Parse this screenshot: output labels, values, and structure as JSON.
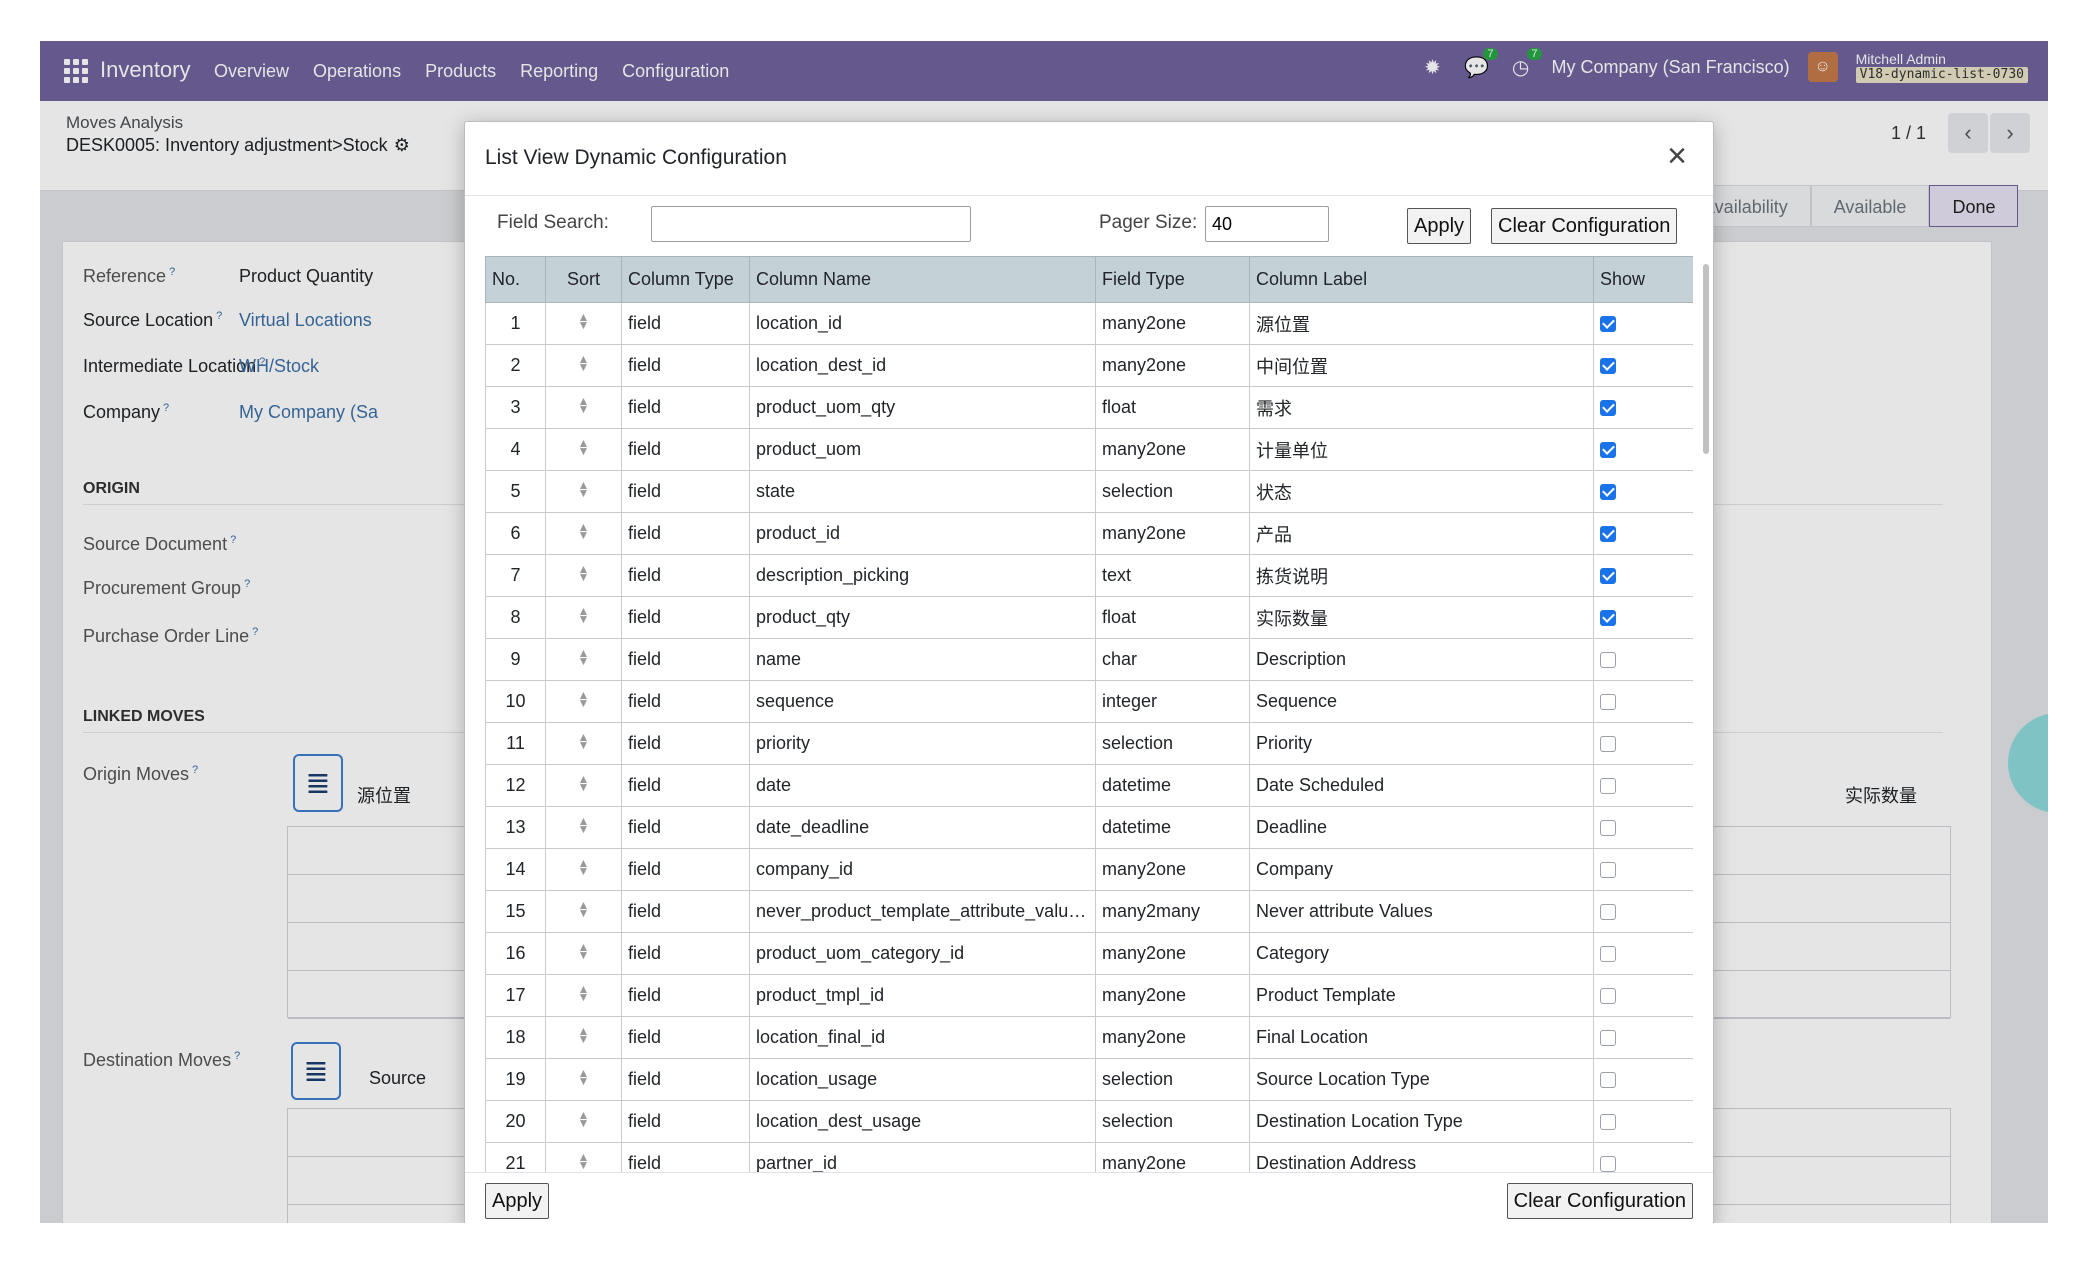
{
  "navbar": {
    "app_name": "Inventory",
    "menu": [
      "Overview",
      "Operations",
      "Products",
      "Reporting",
      "Configuration"
    ],
    "activity_badge": "7",
    "messages_badge": "7",
    "company": "My Company (San Francisco)",
    "user_name": "Mitchell Admin",
    "db_name": "V18-dynamic-list-0730"
  },
  "control_panel": {
    "breadcrumb_parent": "Moves Analysis",
    "breadcrumb_current": "DESK0005: Inventory adjustment>Stock",
    "pager": "1 / 1"
  },
  "statusbar": [
    "Availability",
    "Available",
    "Done"
  ],
  "form": {
    "fields": [
      {
        "label": "Reference",
        "value": "Product Quantity"
      },
      {
        "label": "Source Location",
        "value": "Virtual Locations"
      },
      {
        "label": "Intermediate Location",
        "value": "WH/Stock"
      },
      {
        "label": "Company",
        "value": "My Company (Sa"
      }
    ],
    "origin_section": "ORIGIN",
    "origin_fields": [
      "Source Document",
      "Procurement Group",
      "Purchase Order Line"
    ],
    "linked_section": "LINKED MOVES",
    "origin_moves_label": "Origin Moves",
    "origin_moves_col1": "源位置",
    "origin_moves_col_right": "实际数量",
    "dest_moves_label": "Destination Moves",
    "dest_moves_col1": "Source"
  },
  "modal": {
    "title": "List View Dynamic Configuration",
    "field_search_label": "Field Search:",
    "field_search_value": "",
    "pager_size_label": "Pager Size:",
    "pager_size_value": "40",
    "apply_label": "Apply",
    "clear_label": "Clear Configuration",
    "columns": [
      "No.",
      "Sort",
      "Column Type",
      "Column Name",
      "Field Type",
      "Column Label",
      "Show"
    ],
    "rows": [
      {
        "no": "1",
        "type": "field",
        "name": "location_id",
        "ftype": "many2one",
        "label": "源位置",
        "show": true
      },
      {
        "no": "2",
        "type": "field",
        "name": "location_dest_id",
        "ftype": "many2one",
        "label": "中间位置",
        "show": true
      },
      {
        "no": "3",
        "type": "field",
        "name": "product_uom_qty",
        "ftype": "float",
        "label": "需求",
        "show": true
      },
      {
        "no": "4",
        "type": "field",
        "name": "product_uom",
        "ftype": "many2one",
        "label": "计量单位",
        "show": true
      },
      {
        "no": "5",
        "type": "field",
        "name": "state",
        "ftype": "selection",
        "label": "状态",
        "show": true
      },
      {
        "no": "6",
        "type": "field",
        "name": "product_id",
        "ftype": "many2one",
        "label": "产品",
        "show": true
      },
      {
        "no": "7",
        "type": "field",
        "name": "description_picking",
        "ftype": "text",
        "label": "拣货说明",
        "show": true
      },
      {
        "no": "8",
        "type": "field",
        "name": "product_qty",
        "ftype": "float",
        "label": "实际数量",
        "show": true
      },
      {
        "no": "9",
        "type": "field",
        "name": "name",
        "ftype": "char",
        "label": "Description",
        "show": false
      },
      {
        "no": "10",
        "type": "field",
        "name": "sequence",
        "ftype": "integer",
        "label": "Sequence",
        "show": false
      },
      {
        "no": "11",
        "type": "field",
        "name": "priority",
        "ftype": "selection",
        "label": "Priority",
        "show": false
      },
      {
        "no": "12",
        "type": "field",
        "name": "date",
        "ftype": "datetime",
        "label": "Date Scheduled",
        "show": false
      },
      {
        "no": "13",
        "type": "field",
        "name": "date_deadline",
        "ftype": "datetime",
        "label": "Deadline",
        "show": false
      },
      {
        "no": "14",
        "type": "field",
        "name": "company_id",
        "ftype": "many2one",
        "label": "Company",
        "show": false
      },
      {
        "no": "15",
        "type": "field",
        "name": "never_product_template_attribute_value...",
        "ftype": "many2many",
        "label": "Never attribute Values",
        "show": false
      },
      {
        "no": "16",
        "type": "field",
        "name": "product_uom_category_id",
        "ftype": "many2one",
        "label": "Category",
        "show": false
      },
      {
        "no": "17",
        "type": "field",
        "name": "product_tmpl_id",
        "ftype": "many2one",
        "label": "Product Template",
        "show": false
      },
      {
        "no": "18",
        "type": "field",
        "name": "location_final_id",
        "ftype": "many2one",
        "label": "Final Location",
        "show": false
      },
      {
        "no": "19",
        "type": "field",
        "name": "location_usage",
        "ftype": "selection",
        "label": "Source Location Type",
        "show": false
      },
      {
        "no": "20",
        "type": "field",
        "name": "location_dest_usage",
        "ftype": "selection",
        "label": "Destination Location Type",
        "show": false
      },
      {
        "no": "21",
        "type": "field",
        "name": "partner_id",
        "ftype": "many2one",
        "label": "Destination Address",
        "show": false
      }
    ]
  },
  "colors": {
    "navbar": "#71639e",
    "header_row": "#c4d2d8",
    "checkbox_on": "#1a73e8",
    "link": "#3c6fa6"
  }
}
